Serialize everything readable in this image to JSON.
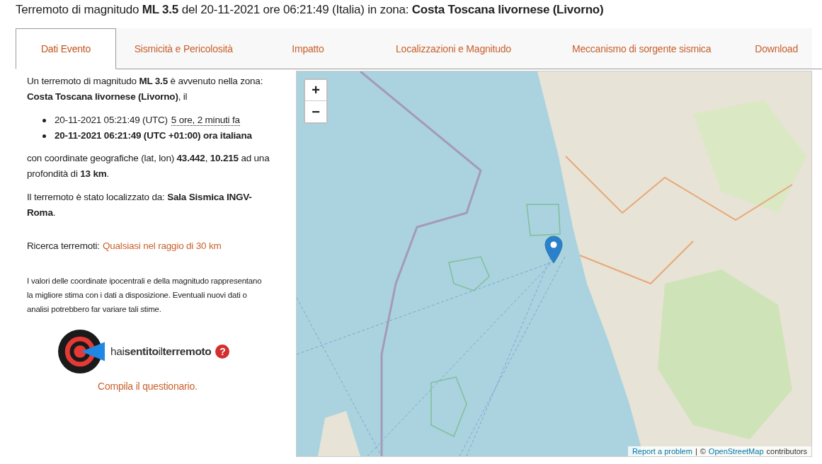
{
  "title": "Terremoto di magnitudo **ML 3.5** del 20-11-2021 ore 06:21:49 (Italia) in zona: **Costa Toscana livornese (Livorno)**",
  "tabs": [
    {
      "label": "Dati Evento",
      "selected": true
    },
    {
      "label": "Sismicità e Pericolosità",
      "selected": false
    },
    {
      "label": "Impatto",
      "selected": false
    },
    {
      "label": "Localizzazioni e Magnitudo",
      "selected": false
    },
    {
      "label": "Meccanismo di sorgente sismica",
      "selected": false
    },
    {
      "label": "Download",
      "selected": false
    }
  ],
  "summary": {
    "intro": "Un terremoto di magnitudo **ML 3.5** è avvenuto nella zona: **Costa Toscana livornese (Livorno)**, il",
    "times": [
      {
        "text": "20-11-2021 05:21:49 (UTC)",
        "relative": "5 ore, 2 minuti fa",
        "bold": false
      },
      {
        "text": "20-11-2021 06:21:49 (UTC +01:00) ora italiana",
        "bold": true
      }
    ],
    "coordinates": "con coordinate geografiche (lat, lon) **43.442**, **10.215** ad una profondità di **13 km**.",
    "located_by": "Il terremoto è stato localizzato da: **Sala Sismica INGV-Roma**.",
    "search": {
      "label": "Ricerca terremoti:",
      "link": "Qualsiasi nel raggio di 30 km"
    },
    "disclaimer": "I valori delle coordinate ipocentrali e della magnitudo rappresentano la migliore stima con i dati a disposizione. Eventuali nuovi dati o analisi potrebbero far variare tali stime.",
    "logo": {
      "text": "hai**sentito**il**terremoto**",
      "help": "?"
    },
    "questionnaire": "Compila il questionario."
  },
  "map": {
    "zoom_in": "+",
    "zoom_out": "−",
    "attribution": {
      "report": "Report a problem",
      "separator": "|",
      "copyright": "©",
      "osm": "OpenStreetMap",
      "suffix": "contributors"
    }
  }
}
